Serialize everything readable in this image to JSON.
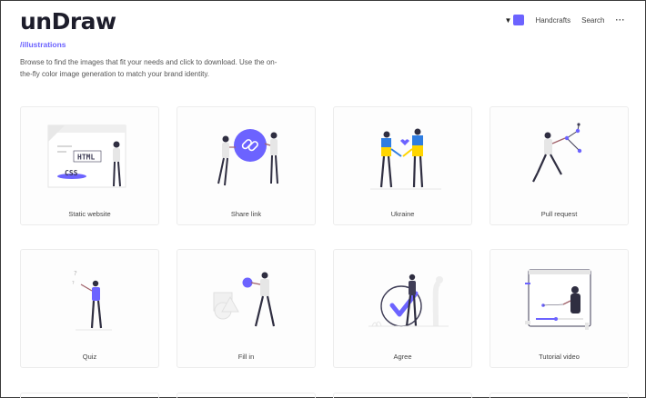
{
  "header": {
    "logo": "unDraw",
    "accent_color": "#6c63ff",
    "nav": {
      "color_caret_icon": "caret-down",
      "handcrafts_label": "Handcrafts",
      "search_label": "Search",
      "more_label": "···"
    }
  },
  "breadcrumb": "/illustrations",
  "description": "Browse to find the images that fit your needs and click to download. Use the on-the-fly color image generation to match your brand identity.",
  "illustrations": [
    {
      "title": "Static website"
    },
    {
      "title": "Share link"
    },
    {
      "title": "Ukraine"
    },
    {
      "title": "Pull request"
    },
    {
      "title": "Quiz"
    },
    {
      "title": "Fill in"
    },
    {
      "title": "Agree"
    },
    {
      "title": "Tutorial video"
    }
  ],
  "card_art": {
    "static_html_text": "HTML",
    "static_css_text": "CSS"
  }
}
